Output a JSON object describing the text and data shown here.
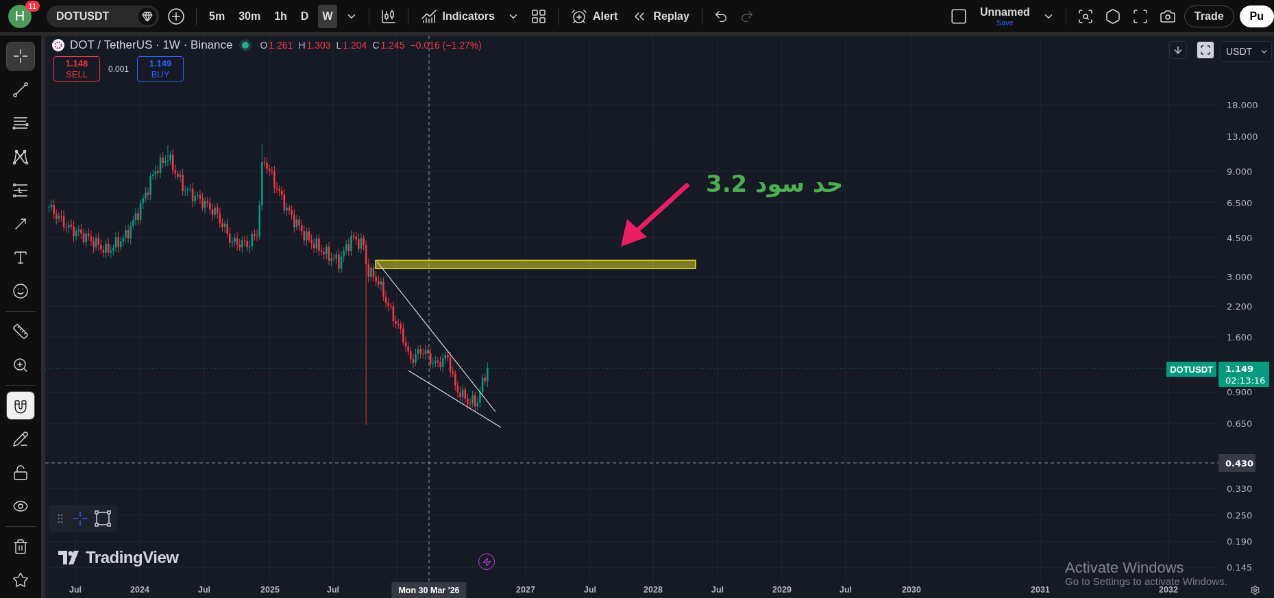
{
  "top_bar": {
    "avatar": {
      "letter": "H",
      "badge": "11"
    },
    "symbol": "DOTUSDT",
    "intervals": [
      {
        "label": "5m",
        "selected": false
      },
      {
        "label": "30m",
        "selected": false
      },
      {
        "label": "1h",
        "selected": false
      },
      {
        "label": "D",
        "selected": false
      },
      {
        "label": "W",
        "selected": true
      }
    ],
    "indicators": "Indicators",
    "alert": "Alert",
    "replay": "Replay",
    "undo": {
      "disabled": false
    },
    "redo": {
      "disabled": true
    },
    "layout": {
      "name": "Unnamed",
      "save": "Save"
    },
    "buttons": [
      {
        "label": "Trade",
        "kind": "outline"
      },
      {
        "label": "Pu",
        "kind": "filled"
      }
    ]
  },
  "left_toolbar": {
    "items": [
      {
        "kind": "crosshair",
        "selected": true
      },
      {
        "kind": "trend-line",
        "selected": false
      },
      {
        "kind": "fib",
        "selected": false
      },
      {
        "kind": "pattern",
        "selected": false
      },
      {
        "kind": "position",
        "selected": false
      },
      {
        "kind": "arrow",
        "selected": false
      },
      {
        "kind": "text",
        "selected": false
      },
      {
        "kind": "emoji",
        "selected": false
      },
      {
        "kind": "divider"
      },
      {
        "kind": "ruler",
        "selected": false
      },
      {
        "kind": "zoom",
        "selected": false
      },
      {
        "kind": "divider"
      },
      {
        "kind": "magnet",
        "selected": true
      },
      {
        "kind": "lock-drawings",
        "selected": false
      },
      {
        "kind": "lock",
        "selected": false
      },
      {
        "kind": "hide",
        "selected": false
      },
      {
        "kind": "divider"
      },
      {
        "kind": "trash",
        "selected": false
      },
      {
        "kind": "favorite",
        "selected": false
      }
    ]
  },
  "chart": {
    "legend": {
      "title": "DOT / TetherUS · 1W · Binance",
      "market_open": true,
      "ohlc": [
        {
          "key": "O",
          "value": "1.261"
        },
        {
          "key": "H",
          "value": "1.303"
        },
        {
          "key": "L",
          "value": "1.204"
        },
        {
          "key": "C",
          "value": "1.245"
        }
      ],
      "change": "−0.016 (−1.27%)"
    },
    "trade": {
      "sell_price": "1.148",
      "sell": "SELL",
      "spread": "0.001",
      "buy_price": "1.149",
      "buy": "BUY"
    },
    "currency": "USDT",
    "annotation": {
      "text": "حد سود 3.2"
    },
    "price_axis": {
      "labels": [
        "18.000",
        "13.000",
        "9.000",
        "6.500",
        "4.500",
        "3.000",
        "2.200",
        "1.600",
        "0.900",
        "0.650",
        "0.330",
        "0.250",
        "0.190",
        "0.145"
      ],
      "last_price": {
        "symbol": "DOTUSDT",
        "price": "1.149",
        "countdown": "02:13:16"
      },
      "crosshair_price": "0.430"
    },
    "time_axis": {
      "labels": [
        "Jul",
        "2024",
        "Jul",
        "2025",
        "Jul",
        "2027",
        "Jul",
        "2028",
        "Jul",
        "2029",
        "Jul",
        "2030",
        "2031",
        "2032"
      ],
      "crosshair_time": "Mon 30 Mar '26"
    },
    "logo": "TradingView"
  },
  "os_overlay": {
    "title": "Activate Windows",
    "subtitle": "Go to Settings to activate Windows."
  }
}
